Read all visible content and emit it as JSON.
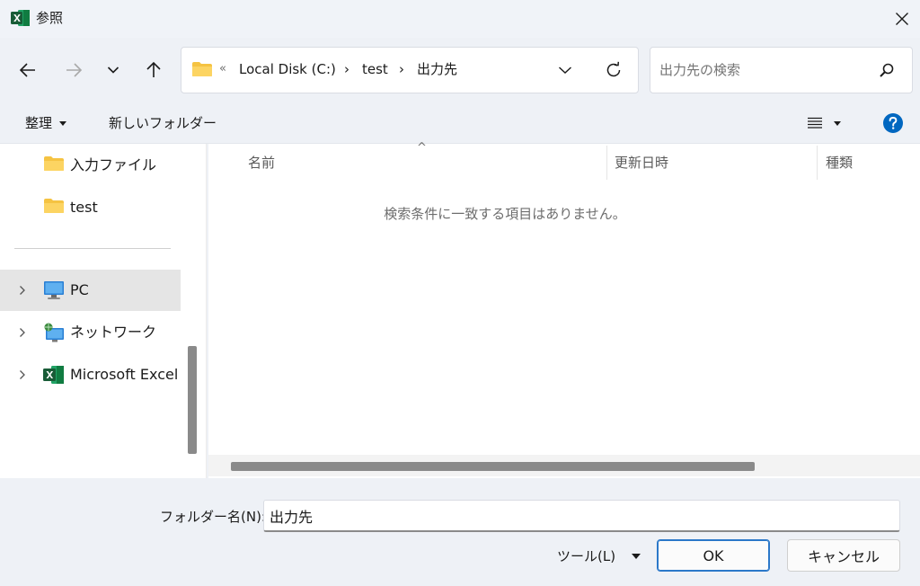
{
  "window": {
    "title": "参照",
    "app_icon": "excel-icon"
  },
  "navigation": {
    "back": "back-arrow-icon",
    "forward": "forward-arrow-icon",
    "recent": "chevron-down-icon",
    "up": "up-arrow-icon"
  },
  "address_bar": {
    "overflow": "«",
    "crumbs": [
      "Local Disk (C:)",
      "test",
      "出力先"
    ],
    "separator": "›"
  },
  "search": {
    "placeholder": "出力先の検索"
  },
  "commands": {
    "organize": "整理",
    "new_folder": "新しいフォルダー"
  },
  "sidebar": {
    "items": [
      {
        "label": "入力ファイル",
        "icon": "folder-icon"
      },
      {
        "label": "test",
        "icon": "folder-icon"
      },
      {
        "label": "PC",
        "icon": "pc-icon",
        "selected": true
      },
      {
        "label": "ネットワーク",
        "icon": "network-icon"
      },
      {
        "label": "Microsoft Excel",
        "icon": "excel-icon"
      }
    ]
  },
  "file_list": {
    "columns": [
      "名前",
      "更新日時",
      "種類"
    ],
    "sort_indicator": "^",
    "empty_message": "検索条件に一致する項目はありません。"
  },
  "footer": {
    "folder_name_label": "フォルダー名(N):",
    "folder_name_value": "出力先",
    "tools_label": "ツール(L)",
    "ok_label": "OK",
    "cancel_label": "キャンセル"
  },
  "colors": {
    "accent": "#0067c0",
    "folder": "#f5c342",
    "excel": "#1d6f42"
  }
}
